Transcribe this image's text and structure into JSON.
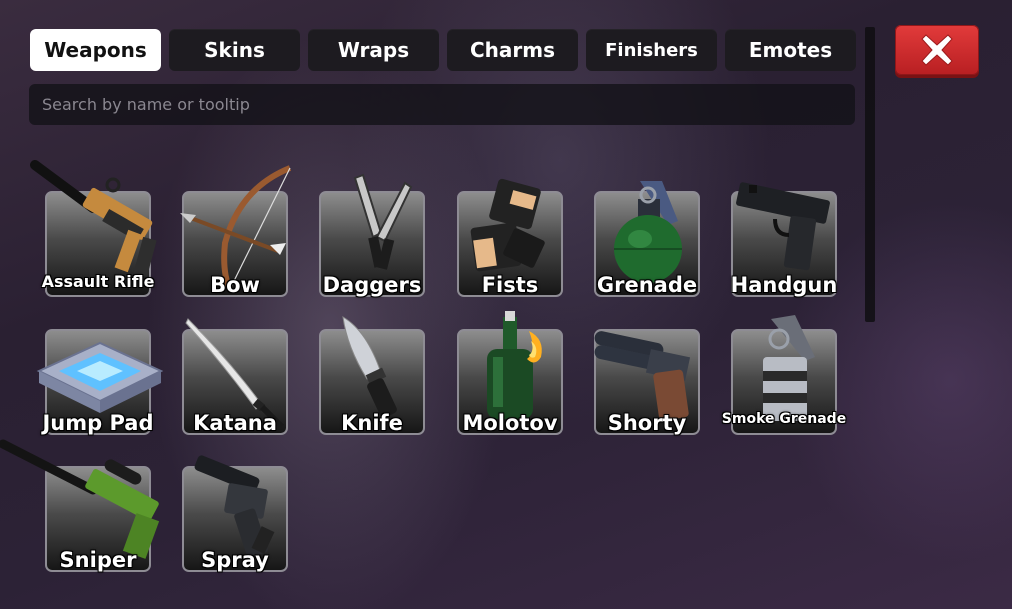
{
  "tabs": [
    {
      "label": "Weapons",
      "active": true
    },
    {
      "label": "Skins",
      "active": false
    },
    {
      "label": "Wraps",
      "active": false
    },
    {
      "label": "Charms",
      "active": false
    },
    {
      "label": "Finishers",
      "active": false
    },
    {
      "label": "Emotes",
      "active": false
    }
  ],
  "search": {
    "placeholder": "Search by name or tooltip",
    "value": ""
  },
  "close_button": {
    "icon": "close-x-icon",
    "color": "#d92d2d"
  },
  "weapons": [
    {
      "label": "Assault Rifle",
      "icon": "assault-rifle-icon"
    },
    {
      "label": "Bow",
      "icon": "bow-icon"
    },
    {
      "label": "Daggers",
      "icon": "daggers-icon"
    },
    {
      "label": "Fists",
      "icon": "fists-icon"
    },
    {
      "label": "Grenade",
      "icon": "grenade-icon"
    },
    {
      "label": "Handgun",
      "icon": "handgun-icon"
    },
    {
      "label": "Jump Pad",
      "icon": "jump-pad-icon"
    },
    {
      "label": "Katana",
      "icon": "katana-icon"
    },
    {
      "label": "Knife",
      "icon": "knife-icon"
    },
    {
      "label": "Molotov",
      "icon": "molotov-icon"
    },
    {
      "label": "Shorty",
      "icon": "shorty-icon"
    },
    {
      "label": "Smoke Grenade",
      "icon": "smoke-grenade-icon"
    },
    {
      "label": "Sniper",
      "icon": "sniper-icon"
    },
    {
      "label": "Spray",
      "icon": "spray-icon"
    }
  ]
}
